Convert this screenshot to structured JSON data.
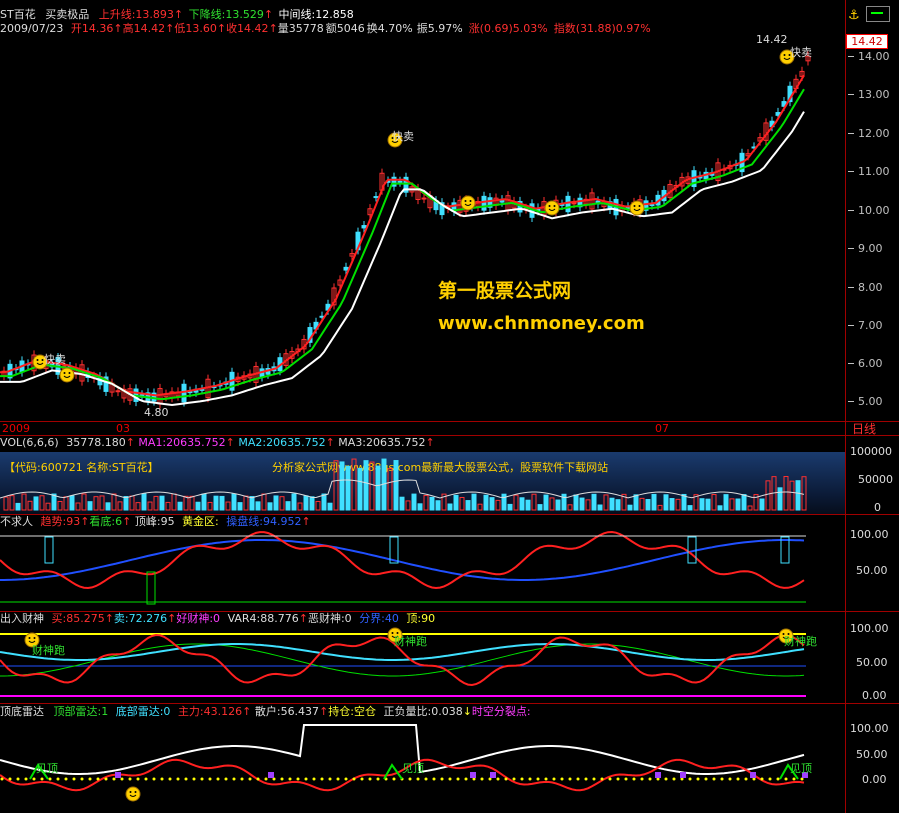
{
  "header": {
    "row1": {
      "name": "ST百花",
      "indicator": "买卖极品",
      "up_line": "上升线:13.893",
      "down_line": "下降线:13.529",
      "mid_line": "中间线:12.858"
    },
    "row2": {
      "date": "2009/07/23",
      "open": "开14.36",
      "high": "高14.42",
      "low": "低13.60",
      "close": "收14.42",
      "volume": "量35778",
      "amount": "额5046",
      "turnover": "换4.70%",
      "amplitude": "振5.97%",
      "change": "涨(0.69)5.03%",
      "index": "指数(31.88)0.97%"
    }
  },
  "price_axis": {
    "current_price": "14.42",
    "ticks": [
      "14.00",
      "13.00",
      "12.00",
      "11.00",
      "10.00",
      "9.00",
      "8.00",
      "7.00",
      "6.00",
      "5.00"
    ],
    "max_label": "14.42",
    "min_label": "4.80"
  },
  "date_axis": {
    "labels": [
      "2009",
      "03",
      "07"
    ],
    "period": "日线"
  },
  "watermark": {
    "line1": "第一股票公式网",
    "line2": "www.chnmoney.com"
  },
  "signals": {
    "sell": "卖",
    "sell_text": "快卖",
    "buy_text": "快买"
  },
  "volume_panel": {
    "title": "VOL(6,6,6)",
    "vol": "35778.180",
    "ma1": "MA1:20635.752",
    "ma2": "MA2:20635.752",
    "ma3": "MA3:20635.752",
    "info": "【代码:600721 名称:ST百花】",
    "info2": "分析家公式网www.88gs.com最新最大股票公式，股票软件下载网站",
    "ticks": [
      "100000",
      "50000",
      "0"
    ]
  },
  "panel2": {
    "title": "不求人",
    "trend": "趋势:93",
    "bottom": "看底:6",
    "top": "顶峰:95",
    "gold": "黄金区:",
    "control": "操盘线:94.952",
    "ticks": [
      "100.00",
      "50.00"
    ]
  },
  "panel3": {
    "title": "出入财神",
    "buy": "买:85.275",
    "sell": "卖:72.276",
    "good": "好财神:0",
    "var4": "VAR4:88.776",
    "bad": "恶财神:0",
    "split": "分界:40",
    "top": "顶:90",
    "sig1": "财神跑",
    "sig2": "财神跑",
    "sig3": "财神跑",
    "ticks": [
      "100.00",
      "50.00",
      "0.00"
    ]
  },
  "panel4": {
    "title": "顶底雷达",
    "top_radar": "顶部雷达:1",
    "bottom_radar": "底部雷达:0",
    "main": "主力:43.126",
    "retail": "散户:56.437",
    "hold": "持仓:空仓",
    "ratio": "正负量比:0.038",
    "split": "时空分裂点:",
    "sig": "见顶",
    "ticks": [
      "100.00",
      "50.00",
      "0.00"
    ]
  },
  "colors": {
    "red": "#ff2020",
    "green": "#00e000",
    "white": "#ffffff",
    "cyan": "#40e0ff",
    "yellow": "#ffff00",
    "blue": "#2050ff",
    "magenta": "#ff00ff"
  }
}
